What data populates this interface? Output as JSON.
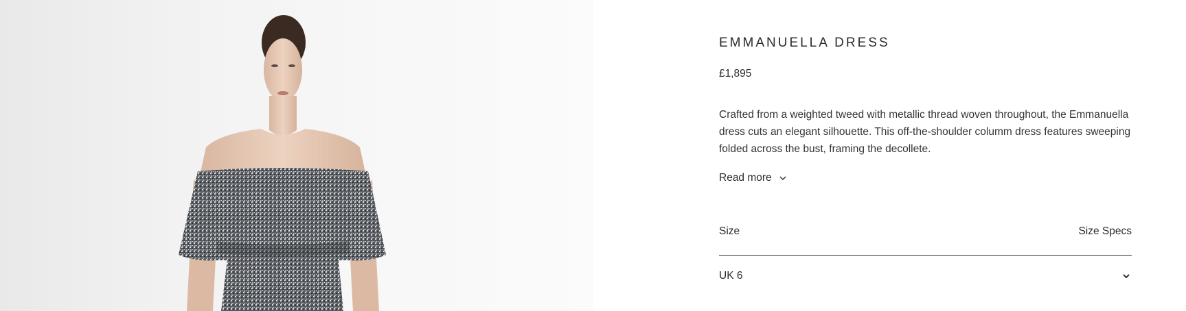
{
  "product": {
    "title": "EMMANUELLA DRESS",
    "price": "£1,895",
    "description": "Crafted from a weighted tweed with metallic thread woven throughout, the Emmanuella dress cuts an elegant silhouette. This off-the-shoulder columm dress features sweeping folded across the bust, framing the decollete.",
    "read_more_label": "Read more",
    "read_more_icon": "chevron-down-icon"
  },
  "size": {
    "label": "Size",
    "specs_label": "Size Specs",
    "selected": "UK 6",
    "select_icon": "chevron-down-icon"
  },
  "photo": {
    "subject": "model-wearing-dress",
    "background_color": "#f2f2f2"
  }
}
